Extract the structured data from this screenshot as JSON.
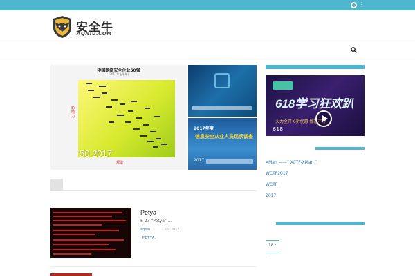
{
  "topbar": {
    "user_icon": "user-icon",
    "user_menu": "⋮",
    "color": "#4fb6cf"
  },
  "logo": {
    "text": "安全牛",
    "sub": "AQNIU.COM"
  },
  "nav": {
    "search_icon": "search-icon"
  },
  "hero": {
    "main": {
      "chart_title": "中国网络安全企业50强",
      "chart_subtitle": "（2017年上半年）",
      "x_label": "规模",
      "y_label": "影响力",
      "caption": "50  2017"
    },
    "side1": {
      "text": ""
    },
    "side2": {
      "year": "2017年度",
      "title": "信息安全从业人员现状调查",
      "caption": "2017"
    }
  },
  "sidebar": {
    "ad": {
      "logo": "",
      "title": "618学习狂欢趴",
      "sub": "火力全开  6折优惠  惊喜不停",
      "label": "618"
    },
    "links": [
      "XMan     ——“     XCTF-XMan    ”",
      "WCTF2017",
      "           WCTF",
      "2017"
    ],
    "bottom": {
      "item1": "             ·            18    ·",
      "item2": "·"
    }
  },
  "article": {
    "title": "Petya",
    "excerpt": "6 27       “Petya”                                   ...",
    "meta_author": "aqniu",
    "meta_date": "·   20, 2017",
    "tag": "PETYA,"
  }
}
